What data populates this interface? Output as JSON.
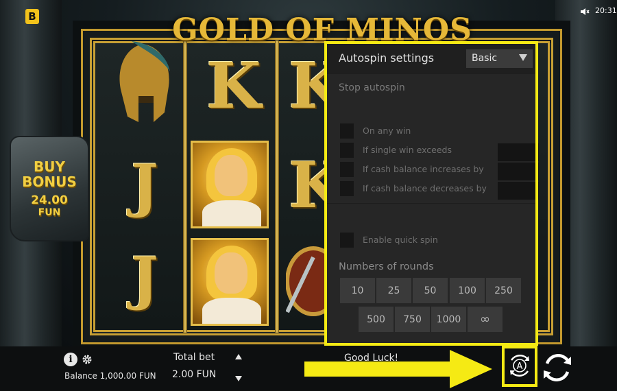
{
  "status": {
    "logo": "B",
    "time": "20:31",
    "sound_icon": "speaker-muted-icon"
  },
  "game": {
    "title": "GOLD OF MINOS"
  },
  "buy_bonus": {
    "line1": "BUY",
    "line2": "BONUS",
    "price": "24.00",
    "currency": "FUN"
  },
  "reels": {
    "symbols": [
      {
        "reel": 1,
        "symbols": [
          "helmet",
          "J",
          "J"
        ]
      },
      {
        "reel": 2,
        "symbols": [
          "K",
          "hero",
          "hero"
        ]
      },
      {
        "reel": 3,
        "symbols": [
          "K",
          "K",
          "shield"
        ]
      }
    ]
  },
  "autospin": {
    "title": "Autospin settings",
    "mode": "Basic",
    "stop_label": "Stop autospin",
    "options": [
      {
        "label": "On any win",
        "has_input": false
      },
      {
        "label": "If single win exceeds",
        "has_input": true
      },
      {
        "label": "If cash balance increases by",
        "has_input": true
      },
      {
        "label": "If cash balance decreases by",
        "has_input": true
      }
    ],
    "quick_spin_label": "Enable quick spin",
    "rounds_label": "Numbers of rounds",
    "rounds": [
      "10",
      "25",
      "50",
      "100",
      "250",
      "500",
      "750",
      "1000",
      "∞"
    ]
  },
  "bottom": {
    "balance": "Balance 1,000.00 FUN",
    "total_bet_label": "Total bet",
    "total_bet_value": "2.00 FUN",
    "message": "Good Luck!",
    "autospin_letter": "A"
  },
  "colors": {
    "highlight": "#f5ea14",
    "gold": "#d9b248",
    "panel": "#262626"
  }
}
